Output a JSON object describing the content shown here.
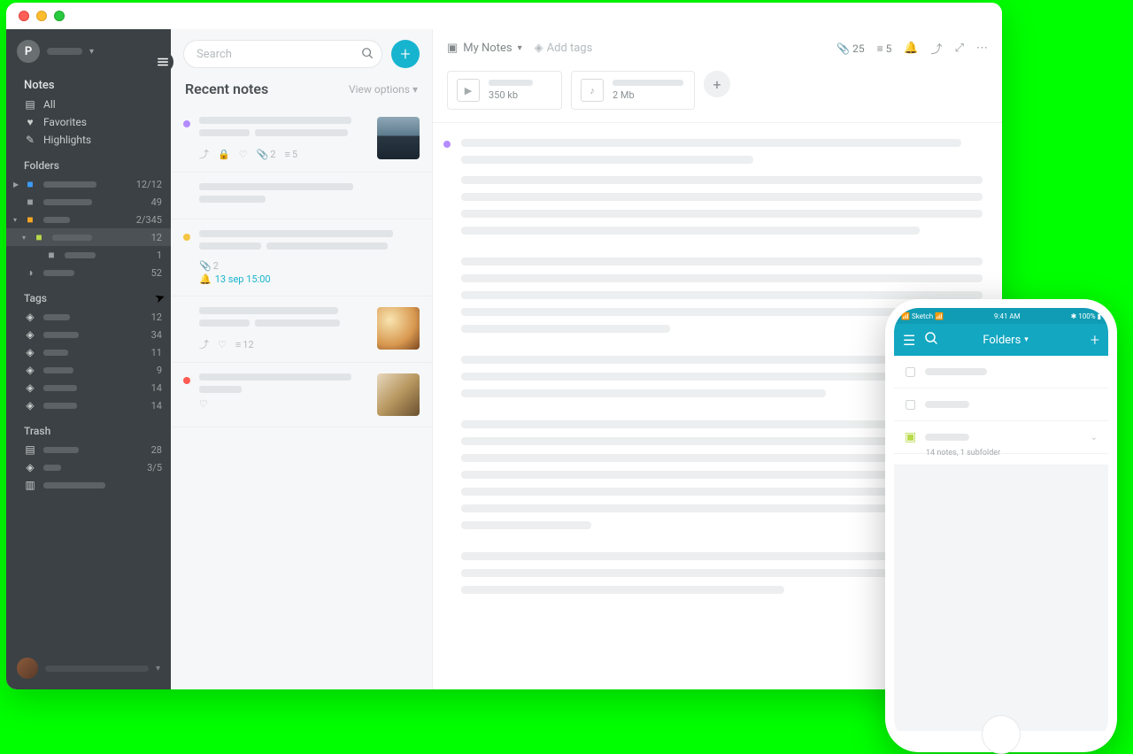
{
  "sidebar": {
    "profile_initial": "P",
    "section_notes": "Notes",
    "items_notes": [
      {
        "label": "All"
      },
      {
        "label": "Favorites"
      },
      {
        "label": "Highlights"
      }
    ],
    "section_folders": "Folders",
    "folders": [
      {
        "color": "#3b9cff",
        "count": "12/12",
        "caret": "right"
      },
      {
        "color": "#9aa0a2",
        "count": "49"
      },
      {
        "color": "#f5a623",
        "count": "2/345",
        "caret": "down"
      },
      {
        "color": "#b8d94a",
        "count": "12",
        "caret": "down",
        "indent": 1,
        "highlight": true
      },
      {
        "color": "#9aa0a2",
        "count": "1",
        "indent": 2
      },
      {
        "color": "#9aa0a2",
        "count": "52",
        "shared": true
      }
    ],
    "section_tags": "Tags",
    "tags": [
      {
        "count": "12"
      },
      {
        "count": "34"
      },
      {
        "count": "11"
      },
      {
        "count": "9"
      },
      {
        "count": "14"
      },
      {
        "count": "14"
      }
    ],
    "section_trash": "Trash",
    "trash": [
      {
        "icon": "note",
        "count": "28"
      },
      {
        "icon": "tag",
        "count": "3/5"
      },
      {
        "icon": "template",
        "count": ""
      }
    ]
  },
  "notelist": {
    "search_placeholder": "Search",
    "title": "Recent notes",
    "view_options": "View options",
    "notes": [
      {
        "color": "#b48cff",
        "thumb": "landscape",
        "share": true,
        "lock": true,
        "heart": true,
        "attach": "2",
        "list": "5"
      },
      {
        "color": null
      },
      {
        "color": "#f5c542",
        "attach": "2",
        "reminder": "13 sep 15:00"
      },
      {
        "color": null,
        "thumb": "food",
        "share": true,
        "heart": true,
        "list": "12"
      },
      {
        "color": "#ff5a52",
        "thumb": "food2",
        "heart": true
      }
    ]
  },
  "editor": {
    "breadcrumb": "My Notes",
    "add_tags": "Add tags",
    "attach_count": "25",
    "list_count": "5",
    "attachments": [
      {
        "type": "video",
        "size": "350 kb"
      },
      {
        "type": "audio",
        "size": "2 Mb"
      }
    ]
  },
  "phone": {
    "status_left": "Sketch",
    "status_time": "9:41 AM",
    "status_right": "100%",
    "nav_title": "Folders",
    "folder_sub": "14 notes, 1 subfolder"
  }
}
